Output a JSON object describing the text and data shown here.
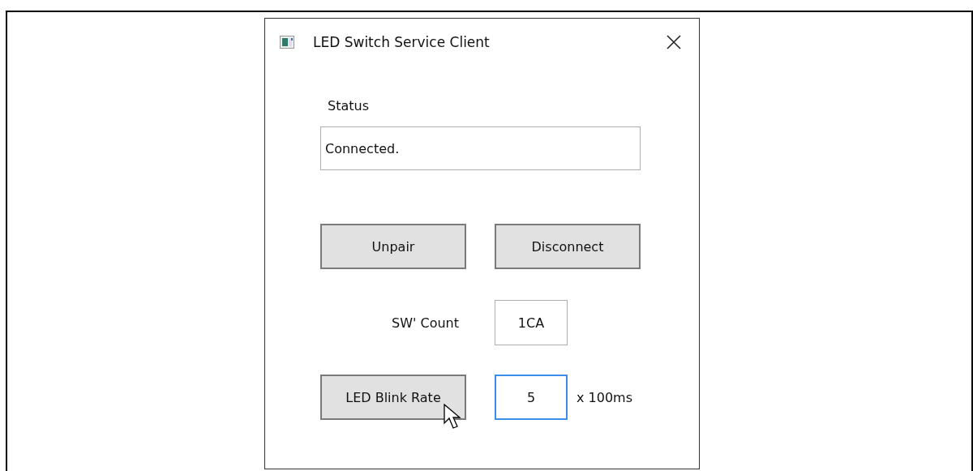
{
  "window": {
    "title": "LED Switch Service Client"
  },
  "status": {
    "label": "Status",
    "value": "Connected."
  },
  "buttons": [
    {
      "label": "Unpair"
    },
    {
      "label": "Disconnect"
    }
  ],
  "sw_count": {
    "label": "SW' Count",
    "value": "1CA",
    "focused": false
  },
  "blink_rate": {
    "button": "LED Blink Rate",
    "value": "5",
    "unit": "x 100ms",
    "focused": true
  }
}
